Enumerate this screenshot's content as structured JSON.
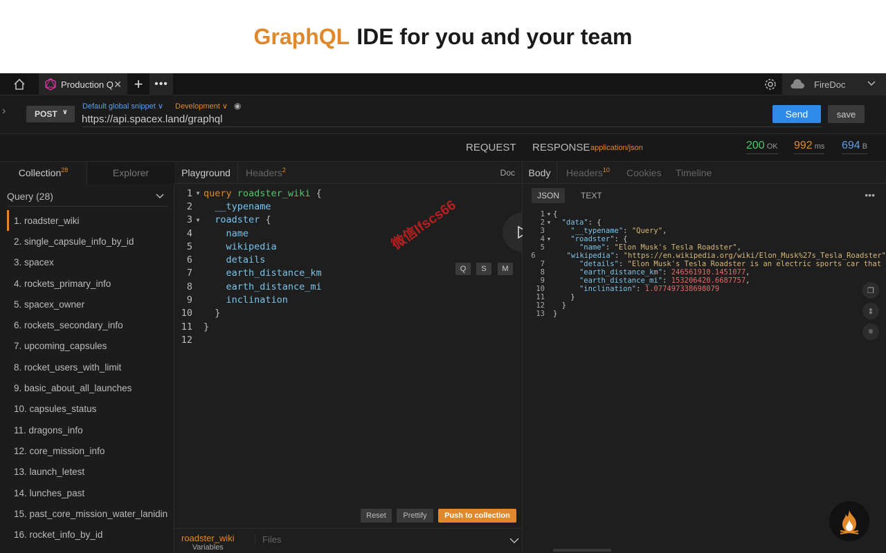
{
  "banner": {
    "brand": "GraphQL",
    "rest": "IDE  for you and your team"
  },
  "tabbar": {
    "tab_title": "Production Q",
    "tab_close": "✕",
    "new_tab": "+",
    "more": "•••",
    "user": "FireDoc"
  },
  "request": {
    "method": "POST",
    "snippet": "Default global snippet",
    "environment": "Development",
    "url": "https://api.spacex.land/graphql",
    "send": "Send",
    "save": "save"
  },
  "labels": {
    "request": "REQUEST",
    "response": "RESPONSE",
    "content_type": "application/json"
  },
  "stats": {
    "status": "200",
    "status_unit": "OK",
    "time": "992",
    "time_unit": "ms",
    "size": "694",
    "size_unit": "B"
  },
  "sidebar": {
    "tab_collection": "Collection",
    "collection_count": "28",
    "tab_explorer": "Explorer",
    "query_header": "Query (28)",
    "items": [
      "1. roadster_wiki",
      "2. single_capsule_info_by_id",
      "3. spacex",
      "4. rockets_primary_info",
      "5. spacex_owner",
      "6. rockets_secondary_info",
      "7. upcoming_capsules",
      "8. rocket_users_with_limit",
      "9. basic_about_all_launches",
      "10. capsules_status",
      "11. dragons_info",
      "12. core_mission_info",
      "13. launch_letest",
      "14. lunches_past",
      "15. past_core_mission_water_lanidin",
      "16. rocket_info_by_id"
    ]
  },
  "editor": {
    "tab_playground": "Playground",
    "tab_headers": "Headers",
    "headers_count": "2",
    "doc": "Doc",
    "btn_q": "Q",
    "btn_s": "S",
    "btn_m": "M",
    "watermark": "微信Ifscs66",
    "reset": "Reset",
    "prettify": "Prettify",
    "push": "Push to collection",
    "bottom_var_name": "roadster_wiki",
    "bottom_var_label": "Variables",
    "bottom_files": "Files"
  },
  "response": {
    "tab_body": "Body",
    "tab_headers": "Headers",
    "headers_count": "10",
    "tab_cookies": "Cookies",
    "tab_timeline": "Timeline",
    "fmt_json": "JSON",
    "fmt_text": "TEXT",
    "more": "•••"
  },
  "colors": {
    "accent": "#e0892c",
    "send": "#2d8ae8",
    "ok": "#52c46b",
    "size": "#5aa0e8"
  }
}
